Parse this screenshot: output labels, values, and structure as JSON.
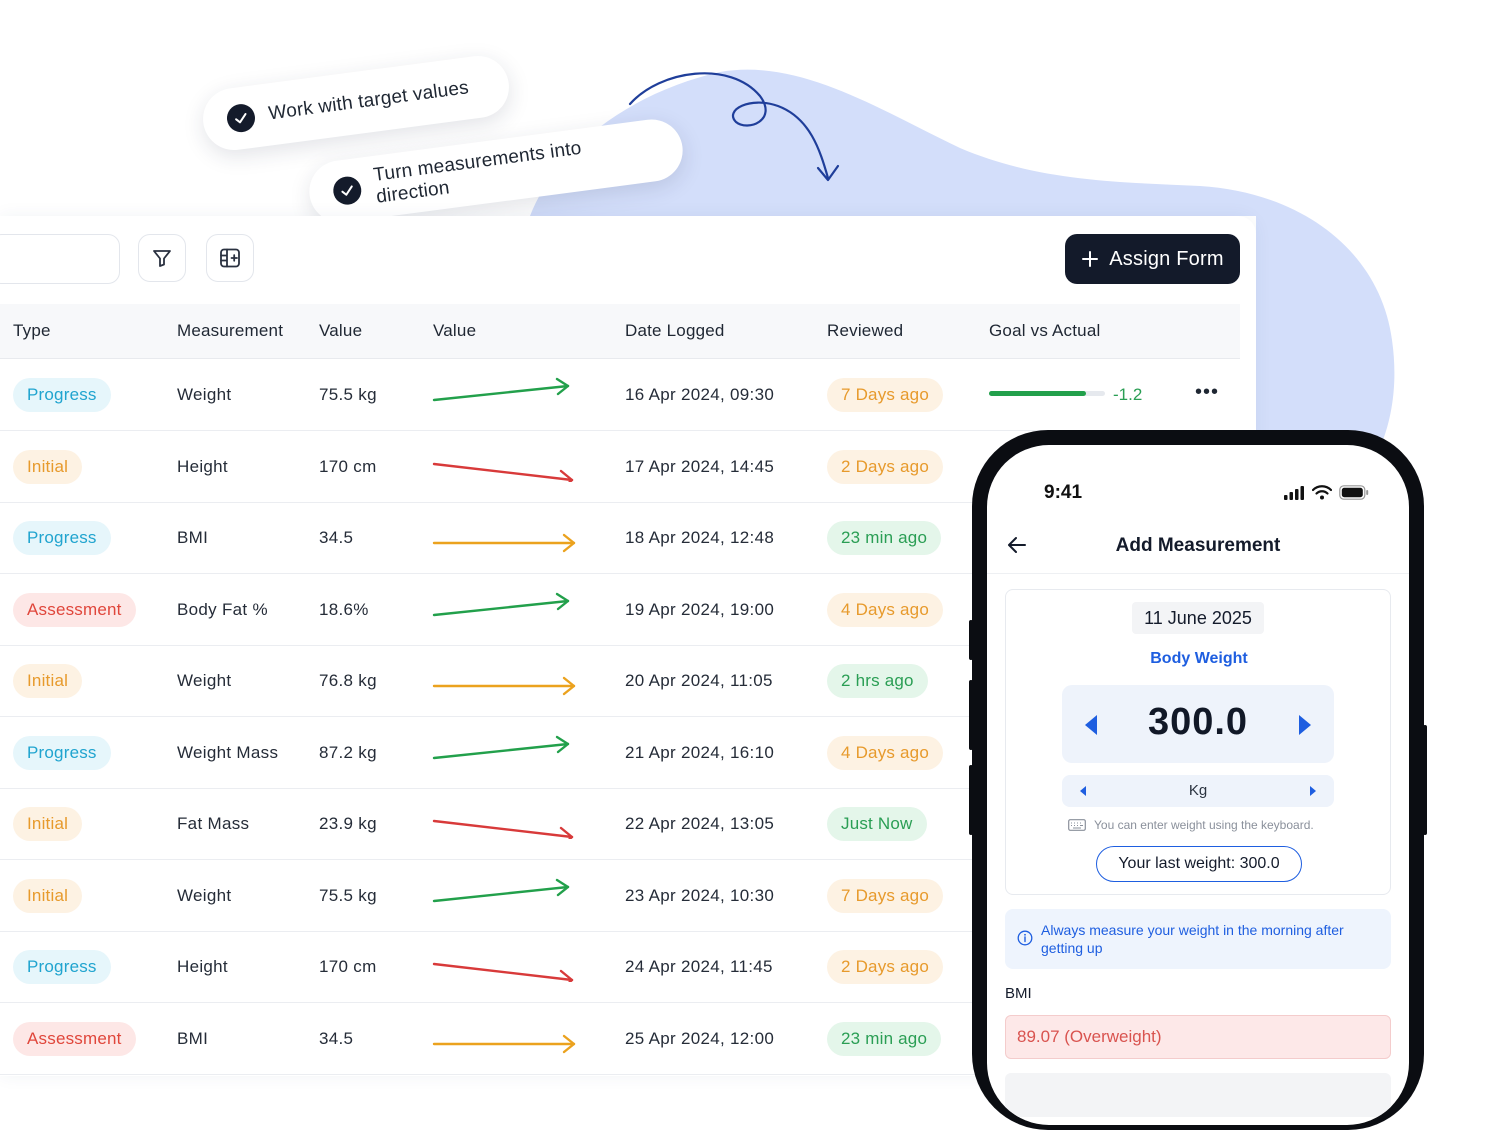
{
  "callouts": {
    "one": "Work with target values",
    "two": "Turn measurements into direction"
  },
  "toolbar": {
    "assign_label": "Assign Form",
    "filter_icon": "filter-icon",
    "columns_icon": "table-columns-icon"
  },
  "table": {
    "headers": [
      "Type",
      "Measurement",
      "Value",
      "Value",
      "Date Logged",
      "Reviewed",
      "Goal vs Actual"
    ],
    "rows": [
      {
        "type": "Progress",
        "type_kind": "progress",
        "measurement": "Weight",
        "value": "75.5 kg",
        "trend": "up",
        "date": "16 Apr 2024, 09:30",
        "reviewed": "7 Days ago",
        "reviewed_kind": "orange",
        "goal_fraction": 0.84,
        "goal_delta": "-1.2"
      },
      {
        "type": "Initial",
        "type_kind": "initial",
        "measurement": "Height",
        "value": "170 cm",
        "trend": "down",
        "date": "17 Apr 2024, 14:45",
        "reviewed": "2 Days ago",
        "reviewed_kind": "orange"
      },
      {
        "type": "Progress",
        "type_kind": "progress",
        "measurement": "BMI",
        "value": "34.5",
        "trend": "flat",
        "date": "18 Apr 2024, 12:48",
        "reviewed": "23 min ago",
        "reviewed_kind": "green"
      },
      {
        "type": "Assessment",
        "type_kind": "assessment",
        "measurement": "Body Fat %",
        "value": "18.6%",
        "trend": "up",
        "date": "19 Apr 2024, 19:00",
        "reviewed": "4 Days ago",
        "reviewed_kind": "orange"
      },
      {
        "type": "Initial",
        "type_kind": "initial",
        "measurement": "Weight",
        "value": "76.8 kg",
        "trend": "flat",
        "date": "20 Apr 2024, 11:05",
        "reviewed": "2 hrs ago",
        "reviewed_kind": "green"
      },
      {
        "type": "Progress",
        "type_kind": "progress",
        "measurement": "Weight Mass",
        "value": "87.2 kg",
        "trend": "up",
        "date": "21 Apr 2024, 16:10",
        "reviewed": "4 Days ago",
        "reviewed_kind": "orange"
      },
      {
        "type": "Initial",
        "type_kind": "initial",
        "measurement": "Fat Mass",
        "value": "23.9 kg",
        "trend": "down",
        "date": "22 Apr 2024, 13:05",
        "reviewed": "Just Now",
        "reviewed_kind": "green"
      },
      {
        "type": "Initial",
        "type_kind": "initial",
        "measurement": "Weight",
        "value": "75.5 kg",
        "trend": "up",
        "date": "23 Apr 2024, 10:30",
        "reviewed": "7 Days ago",
        "reviewed_kind": "orange"
      },
      {
        "type": "Progress",
        "type_kind": "progress",
        "measurement": "Height",
        "value": "170 cm",
        "trend": "down",
        "date": "24 Apr 2024, 11:45",
        "reviewed": "2 Days ago",
        "reviewed_kind": "orange"
      },
      {
        "type": "Assessment",
        "type_kind": "assessment",
        "measurement": "BMI",
        "value": "34.5",
        "trend": "flat",
        "date": "25 Apr 2024, 12:00",
        "reviewed": "23 min ago",
        "reviewed_kind": "green"
      }
    ],
    "row_more_label": "•••"
  },
  "phone": {
    "time": "9:41",
    "title": "Add Measurement",
    "date": "11 June 2025",
    "metric_label": "Body Weight",
    "value": "300.0",
    "unit": "Kg",
    "keyboard_hint": "You can enter weight using the keyboard.",
    "last_weight": "Your last weight: 300.0",
    "tip": "Always measure your weight in the morning after getting up",
    "bmi_label": "BMI",
    "bmi_value": "89.07 (Overweight)"
  },
  "colors": {
    "brand_dark": "#131a2a",
    "accent_blue": "#1e5ee0",
    "blob": "#d3defa",
    "trend_up": "#22a04b",
    "trend_down": "#d83a3a",
    "trend_flat": "#eba21e"
  }
}
